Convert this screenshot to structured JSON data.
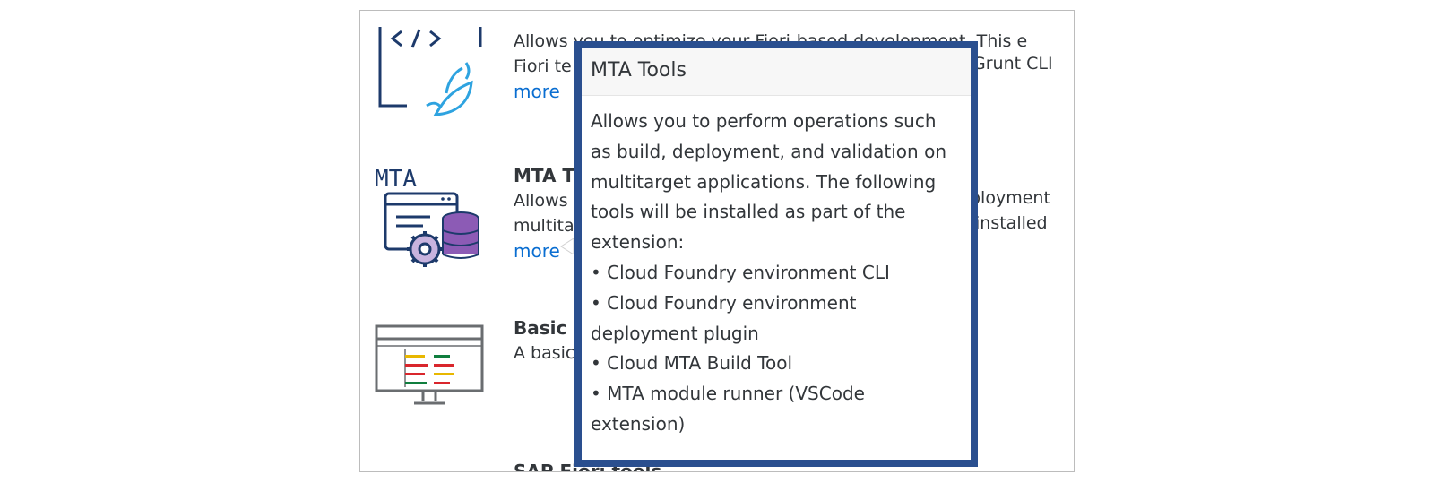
{
  "extensions": [
    {
      "icon": "fiori-tools-icon",
      "title": "",
      "desc_line1": "Allows you to optimize your Fiori-based development. This e",
      "desc_line2": "Fiori te",
      "right_fragment_2": "Grunt CLI",
      "more_label": "more"
    },
    {
      "icon": "mta-tools-icon",
      "icon_text": "MTA",
      "title": "MTA T",
      "desc_line1": "Allows",
      "right_fragment_1": "ployment",
      "desc_line2": "multita",
      "right_fragment_2": "installed",
      "more_label": "more"
    },
    {
      "icon": "basic-tools-icon",
      "title": "Basic S",
      "desc_line1": "A basic",
      "more_label": ""
    },
    {
      "icon": "",
      "title": "SAP Fiori tools",
      "desc_line1": "",
      "more_label": ""
    }
  ],
  "popover": {
    "title": "MTA Tools",
    "lines": [
      "Allows you to perform operations such",
      "as build, deployment, and validation on",
      "multitarget applications. The following",
      "tools will be installed as part of the",
      "extension:",
      "• Cloud Foundry environment CLI",
      "• Cloud Foundry environment",
      "deployment plugin",
      "• Cloud MTA Build Tool",
      "• MTA module runner (VSCode",
      "extension)"
    ]
  },
  "colors": {
    "popover_border": "#2a4f8f",
    "link": "#0a6ed1",
    "text": "#32363a"
  }
}
